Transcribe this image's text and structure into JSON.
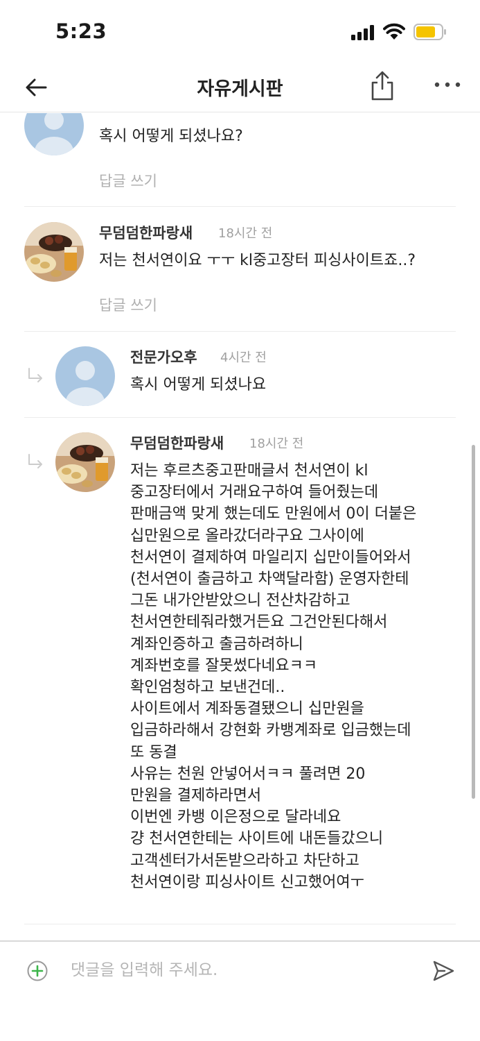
{
  "status_bar": {
    "time": "5:23",
    "battery_color": "#f5c400"
  },
  "nav": {
    "title": "자유게시판",
    "back_icon": "back-arrow-icon",
    "share_icon": "share-icon",
    "more_icon": "more-icon"
  },
  "comments": [
    {
      "author": "",
      "time": "",
      "text": "혹시 어떻게 되셨나요?",
      "reply_label": "답글 쓰기",
      "avatar": "default",
      "is_reply": false
    },
    {
      "author": "무덤덤한파랑새",
      "time": "18시간 전",
      "text": "저는 천서연이요 ㅜㅜ kl중고장터 피싱사이트죠..?",
      "reply_label": "답글 쓰기",
      "avatar": "food-photo",
      "is_reply": false
    },
    {
      "author": "전문가오후",
      "time": "4시간 전",
      "text": "혹시 어떻게 되셨나요",
      "avatar": "default",
      "is_reply": true
    },
    {
      "author": "무덤덤한파랑새",
      "time": "18시간 전",
      "text": "저는 후르츠중고판매글서 천서연이 kl\n중고장터에서 거래요구하여 들어줬는데\n판매금액 맞게 했는데도 만원에서 0이 더붙은\n십만원으로 올라갔더라구요 그사이에\n천서연이 결제하여 마일리지 십만이들어와서\n(천서연이 출금하고 차액달라함) 운영자한테\n그돈 내가안받았으니 전산차감하고\n천서연한테줘라했거든요 그건안된다해서\n계좌인증하고 출금하려하니\n계좌번호를 잘못썼다네요ㅋㅋ\n확인엄청하고 보낸건데..\n사이트에서 계좌동결됐으니 십만원을\n입금하라해서 강현화 카뱅계좌로 입금했는데\n또 동결\n사유는 천원 안넣어서ㅋㅋ 풀려면 20\n만원을 결제하라면서\n이번엔 카뱅 이은정으로 달라네요\n걍 천서연한테는 사이트에 내돈들갔으니\n고객센터가서돈받으라하고 차단하고\n천서연이랑 피싱사이트 신고했어여ㅜ",
      "avatar": "food-photo",
      "is_reply": true
    }
  ],
  "input": {
    "placeholder": "댓글을 입력해 주세요.",
    "value": "",
    "add_icon": "add-circle-icon",
    "send_icon": "send-icon"
  }
}
